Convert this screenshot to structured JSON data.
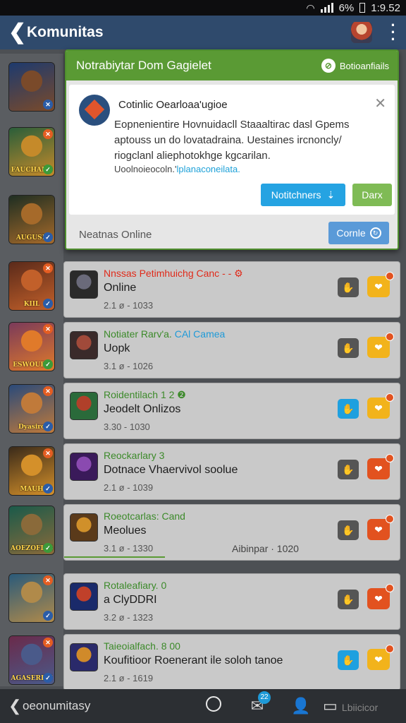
{
  "status": {
    "battery": "6%",
    "time": "1:9.52"
  },
  "appbar": {
    "back_glyph": "❮",
    "title": "Komunitas",
    "more_glyph": "⋮"
  },
  "rail": [
    {
      "caption": "",
      "top_badge": "",
      "bot_badge": "✕",
      "colors": [
        "#1d3a6e",
        "#7a4a2a"
      ]
    },
    {
      "caption": "FAUCHARD",
      "top_badge": "✕",
      "bot_badge": "✓",
      "colors": [
        "#2a5e3a",
        "#c58a2a"
      ]
    },
    {
      "caption": "AUGUSR",
      "top_badge": "",
      "bot_badge": "✓",
      "colors": [
        "#1e2e22",
        "#a66a2a"
      ]
    },
    {
      "caption": "KIIL",
      "top_badge": "✕",
      "bot_badge": "✓",
      "colors": [
        "#5a2a1a",
        "#c2602a"
      ]
    },
    {
      "caption": "ESWOUBE",
      "top_badge": "✕",
      "bot_badge": "✓",
      "colors": [
        "#7a3a5a",
        "#e07a2a"
      ]
    },
    {
      "caption": "Dyasiro",
      "top_badge": "✕",
      "bot_badge": "✓",
      "colors": [
        "#2a4a7a",
        "#c07a3a"
      ]
    },
    {
      "caption": "MAUH",
      "top_badge": "✕",
      "bot_badge": "✓",
      "colors": [
        "#3a2a1a",
        "#d4902a"
      ]
    },
    {
      "caption": "AOEZOFLIB",
      "top_badge": "",
      "bot_badge": "✓",
      "colors": [
        "#1a5a4a",
        "#8a6a3a"
      ]
    },
    {
      "caption": "",
      "top_badge": "✕",
      "bot_badge": "✓",
      "colors": [
        "#2a5a7a",
        "#b08a4a"
      ]
    },
    {
      "caption": "AGASERILY",
      "top_badge": "✕",
      "bot_badge": "✓",
      "colors": [
        "#6a2a4a",
        "#4a5a8a"
      ]
    }
  ],
  "dialog": {
    "title": "Notrabiytar Dom Gagielet",
    "link_label": "Botioanfiails",
    "link_icon": "link-icon",
    "notice": {
      "title": "Cotinlic Oearloaa'ugioe",
      "text": "Eopnenientire Hovnuidacll Staaaltirac dasl Gpems aptouss un do lovatadraina. Uestaines ircnoncly/ riogclanl aliephotokhge kgcarilan.",
      "line_prefix": "Uoolnoieocoln.'",
      "line_link": "lplanaconeilata.",
      "close_glyph": "✕",
      "btn_notif": "Notitchners",
      "btn_notif_icon": "⇣",
      "btn_dark": "Darx"
    },
    "footer_label": "Neatnas Online",
    "footer_btn": "Cornle",
    "footer_btn_icon": "↻"
  },
  "items": [
    {
      "l1": "Nnssas Petimhuichg Canc - - ⚙",
      "l1_color": "#e02a1a",
      "l1_hl": "",
      "l2": "Online",
      "l3": "2.1 ø - 1033",
      "extra": "",
      "act1": "✋",
      "act1_blue": false,
      "act2": "❤",
      "act2_red": false,
      "thumb": [
        "#2a2a2a",
        "#6a6a7a"
      ]
    },
    {
      "l1": "Notiater Rarv'a. ",
      "l1_color": "#3c8a2a",
      "l1_hl": "CAl Camea",
      "l2": "Uopk",
      "l3": "3.1 ø - 1026",
      "extra": "",
      "act1": "✋",
      "act1_blue": false,
      "act2": "❤",
      "act2_red": false,
      "thumb": [
        "#3a2a2a",
        "#a04a3a"
      ]
    },
    {
      "l1": "Roidentilach  1 2 ❷",
      "l1_color": "#3c8a2a",
      "l1_hl": "",
      "l2": "Jeodelt Onlizos",
      "l3": "3.30 - 1030",
      "extra": "",
      "act1": "✋",
      "act1_blue": true,
      "act2": "❤",
      "act2_red": false,
      "thumb": [
        "#2a6a3a",
        "#b0402a"
      ]
    },
    {
      "l1": "Reockarlary  3",
      "l1_color": "#3c8a2a",
      "l1_hl": "",
      "l2": "Dotnace Vhaervivol soolue",
      "l3": "2.1 ø - 1039",
      "extra": "",
      "act1": "✋",
      "act1_blue": false,
      "act2": "❤",
      "act2_red": true,
      "thumb": [
        "#3a1a5a",
        "#8a4ab0"
      ]
    },
    {
      "l1": "Roeotcarlas: Cand",
      "l1_color": "#3c8a2a",
      "l1_hl": "",
      "l2": "Meolues",
      "l3": "3.1 ø - 1330",
      "extra": "Aibinpar · 1020",
      "act1": "✋",
      "act1_blue": false,
      "act2": "❤",
      "act2_red": true,
      "thumb": [
        "#5a3a1a",
        "#d0902a"
      ],
      "progress": 0.3
    },
    {
      "l1": "Rotaleafiary.  0",
      "l1_color": "#3c8a2a",
      "l1_hl": "",
      "l2": "a ClyDDRI",
      "l3": "3.2 ø - 1323",
      "extra": "",
      "act1": "✋",
      "act1_blue": false,
      "act2": "❤",
      "act2_red": true,
      "thumb": [
        "#1a2a6a",
        "#c0402a"
      ]
    },
    {
      "l1": "Taieoialfach.  8 00",
      "l1_color": "#3c8a2a",
      "l1_hl": "",
      "l2": "Koufitioor Roenerant ile soloh tanoe",
      "l3": "2.1 ø - 1619",
      "extra": "",
      "act1": "✋",
      "act1_blue": true,
      "act2": "❤",
      "act2_red": false,
      "thumb": [
        "#2a2a6a",
        "#d08a2a"
      ]
    }
  ],
  "bottomnav": {
    "back_glyph": "❮",
    "label": "oeonumitasy",
    "badge": "22",
    "chat_icon": "chat-icon",
    "profile_icon": "profile-icon",
    "last_label": "Lbiicicor"
  }
}
